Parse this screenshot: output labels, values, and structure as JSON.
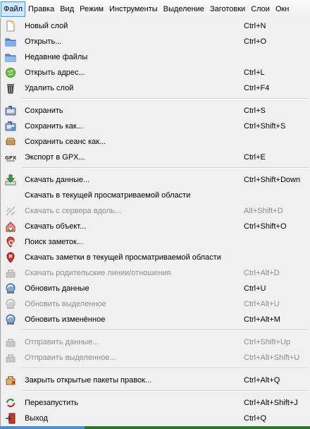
{
  "menubar": {
    "items": [
      "Файл",
      "Правка",
      "Вид",
      "Режим",
      "Инструменты",
      "Выделение",
      "Заготовки",
      "Слои",
      "Окн"
    ],
    "active_index": 0
  },
  "file_menu": {
    "items": [
      {
        "label": "Новый слой",
        "shortcut": "Ctrl+N",
        "icon": "new-layer-icon",
        "enabled": true
      },
      {
        "label": "Открыть...",
        "shortcut": "Ctrl+O",
        "icon": "open-folder-icon",
        "enabled": true
      },
      {
        "label": "Недавние файлы",
        "shortcut": "",
        "icon": "recent-files-icon",
        "enabled": true
      },
      {
        "label": "Открыть адрес...",
        "shortcut": "Ctrl+L",
        "icon": "open-location-icon",
        "enabled": true
      },
      {
        "label": "Удалить слой",
        "shortcut": "Ctrl+F4",
        "icon": "trash-icon",
        "enabled": true
      },
      {
        "label": "Сохранить",
        "shortcut": "Ctrl+S",
        "icon": "save-icon",
        "enabled": true
      },
      {
        "label": "Сохранить как...",
        "shortcut": "Ctrl+Shift+S",
        "icon": "save-as-icon",
        "enabled": true
      },
      {
        "label": "Сохранить сеанс как...",
        "shortcut": "",
        "icon": "save-session-icon",
        "enabled": true
      },
      {
        "label": "Экспорт в GPX...",
        "shortcut": "Ctrl+E",
        "icon": "gpx-export-icon",
        "enabled": true
      },
      {
        "label": "Скачать данные...",
        "shortcut": "Ctrl+Shift+Down",
        "icon": "download-icon",
        "enabled": true
      },
      {
        "label": "Скачать в текущей просматриваемой области",
        "shortcut": "",
        "icon": "",
        "enabled": true
      },
      {
        "label": "Скачать с сервера вдоль...",
        "shortcut": "Alt+Shift+D",
        "icon": "download-along-icon",
        "enabled": false
      },
      {
        "label": "Скачать объект...",
        "shortcut": "Ctrl+Shift+O",
        "icon": "download-object-icon",
        "enabled": true
      },
      {
        "label": "Поиск заметок...",
        "shortcut": "",
        "icon": "search-notes-icon",
        "enabled": true
      },
      {
        "label": "Скачать заметки в текущей просматриваемой области",
        "shortcut": "",
        "icon": "note-pin-icon",
        "enabled": true
      },
      {
        "label": "Скачать родительские линии/отношения",
        "shortcut": "Ctrl+Alt+D",
        "icon": "download-parents-icon",
        "enabled": false
      },
      {
        "label": "Обновить данные",
        "shortcut": "Ctrl+U",
        "icon": "update-data-icon",
        "enabled": true
      },
      {
        "label": "Обновить выделенное",
        "shortcut": "Ctrl+Alt+U",
        "icon": "update-selection-icon",
        "enabled": false
      },
      {
        "label": "Обновить изменённое",
        "shortcut": "Ctrl+Alt+M",
        "icon": "update-modified-icon",
        "enabled": true
      },
      {
        "label": "Отправить данные...",
        "shortcut": "Ctrl+Shift+Up",
        "icon": "upload-icon",
        "enabled": false
      },
      {
        "label": "Отправить выделенное...",
        "shortcut": "Ctrl+Alt+Shift+U",
        "icon": "upload-selection-icon",
        "enabled": false
      },
      {
        "label": "Закрыть открытые пакеты правок...",
        "shortcut": "Ctrl+Alt+Q",
        "icon": "close-changeset-icon",
        "enabled": true
      },
      {
        "label": "Перезапустить",
        "shortcut": "Ctrl+Alt+Shift+J",
        "icon": "restart-icon",
        "enabled": true
      },
      {
        "label": "Выход",
        "shortcut": "Ctrl+Q",
        "icon": "exit-icon",
        "enabled": true
      }
    ]
  },
  "colors": {
    "menu_background": "#f0f0f0",
    "disabled_text": "#8d8d8d",
    "active_menubar_fill": "#cde8ff",
    "active_menubar_border": "#3399ff"
  }
}
